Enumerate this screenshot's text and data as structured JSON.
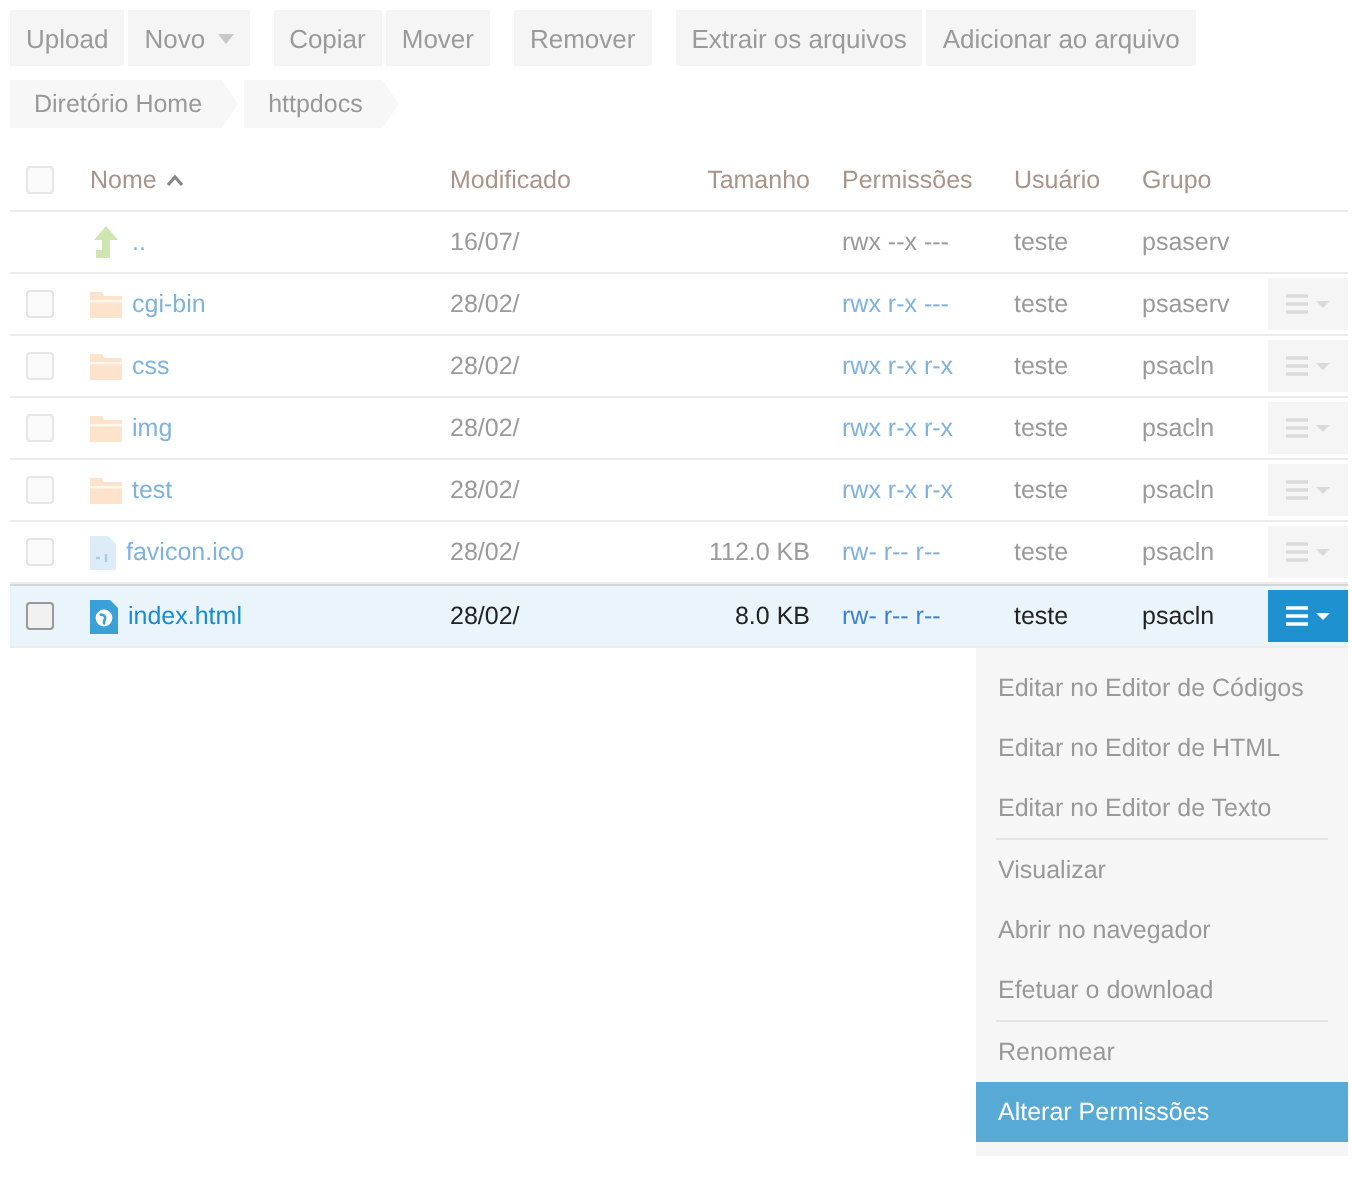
{
  "toolbar": [
    {
      "buttons": [
        {
          "label": "Upload",
          "dropdown": false,
          "disabled": true
        },
        {
          "label": "Novo",
          "dropdown": true,
          "disabled": true
        }
      ]
    },
    {
      "buttons": [
        {
          "label": "Copiar",
          "dropdown": false,
          "disabled": true
        },
        {
          "label": "Mover",
          "dropdown": false,
          "disabled": true
        }
      ]
    },
    {
      "buttons": [
        {
          "label": "Remover",
          "dropdown": false,
          "disabled": true
        }
      ]
    },
    {
      "buttons": [
        {
          "label": "Extrair os arquivos",
          "dropdown": false,
          "disabled": true
        },
        {
          "label": "Adicionar ao arquivo",
          "dropdown": false,
          "disabled": true
        }
      ]
    }
  ],
  "breadcrumb": [
    "Diretório Home",
    "httpdocs"
  ],
  "table": {
    "all_checked": false,
    "columns": [
      {
        "label": "Nome",
        "sorted": true
      },
      {
        "label": "Modificado",
        "sorted": false
      },
      {
        "label": "Tamanho",
        "sorted": false
      },
      {
        "label": "Permissões",
        "sorted": false
      },
      {
        "label": "Usuário",
        "sorted": false
      },
      {
        "label": "Grupo",
        "sorted": false
      }
    ],
    "rows": [
      {
        "kind": "parent",
        "name": "..",
        "modified": "16/07/",
        "size": "",
        "permissions": "rwx --x ---",
        "user": "teste",
        "group": "psaserv",
        "selected": false
      },
      {
        "kind": "folder",
        "name": "cgi-bin",
        "checked": false,
        "modified": "28/02/",
        "size": "",
        "permissions": "rwx r-x ---",
        "user": "teste",
        "group": "psaserv",
        "selected": false
      },
      {
        "kind": "folder",
        "name": "css",
        "checked": false,
        "modified": "28/02/",
        "size": "",
        "permissions": "rwx r-x r-x",
        "user": "teste",
        "group": "psacln",
        "selected": false
      },
      {
        "kind": "folder",
        "name": "img",
        "checked": false,
        "modified": "28/02/",
        "size": "",
        "permissions": "rwx r-x r-x",
        "user": "teste",
        "group": "psacln",
        "selected": false
      },
      {
        "kind": "folder",
        "name": "test",
        "checked": false,
        "modified": "28/02/",
        "size": "",
        "permissions": "rwx r-x r-x",
        "user": "teste",
        "group": "psacln",
        "selected": false
      },
      {
        "kind": "binary",
        "name": "favicon.ico",
        "checked": false,
        "modified": "28/02/",
        "size": "112.0 KB",
        "permissions": "rw- r-- r--",
        "user": "teste",
        "group": "psacln",
        "selected": false
      },
      {
        "kind": "web",
        "name": "index.html",
        "checked": false,
        "modified": "28/02/",
        "size": "8.0 KB",
        "permissions": "rw- r-- r--",
        "user": "teste",
        "group": "psacln",
        "selected": true
      }
    ]
  },
  "context_menu": [
    {
      "kind": "item",
      "label": "Editar no Editor de Códigos",
      "selected": false
    },
    {
      "kind": "item",
      "label": "Editar no Editor de HTML",
      "selected": false
    },
    {
      "kind": "item",
      "label": "Editar no Editor de Texto",
      "selected": false
    },
    {
      "kind": "separator"
    },
    {
      "kind": "item",
      "label": "Visualizar",
      "selected": false
    },
    {
      "kind": "item",
      "label": "Abrir no navegador",
      "selected": false
    },
    {
      "kind": "item",
      "label": "Efetuar o download",
      "selected": false
    },
    {
      "kind": "separator"
    },
    {
      "kind": "item",
      "label": "Renomear",
      "selected": false
    },
    {
      "kind": "item",
      "label": "Alterar Permissões",
      "selected": true
    }
  ]
}
